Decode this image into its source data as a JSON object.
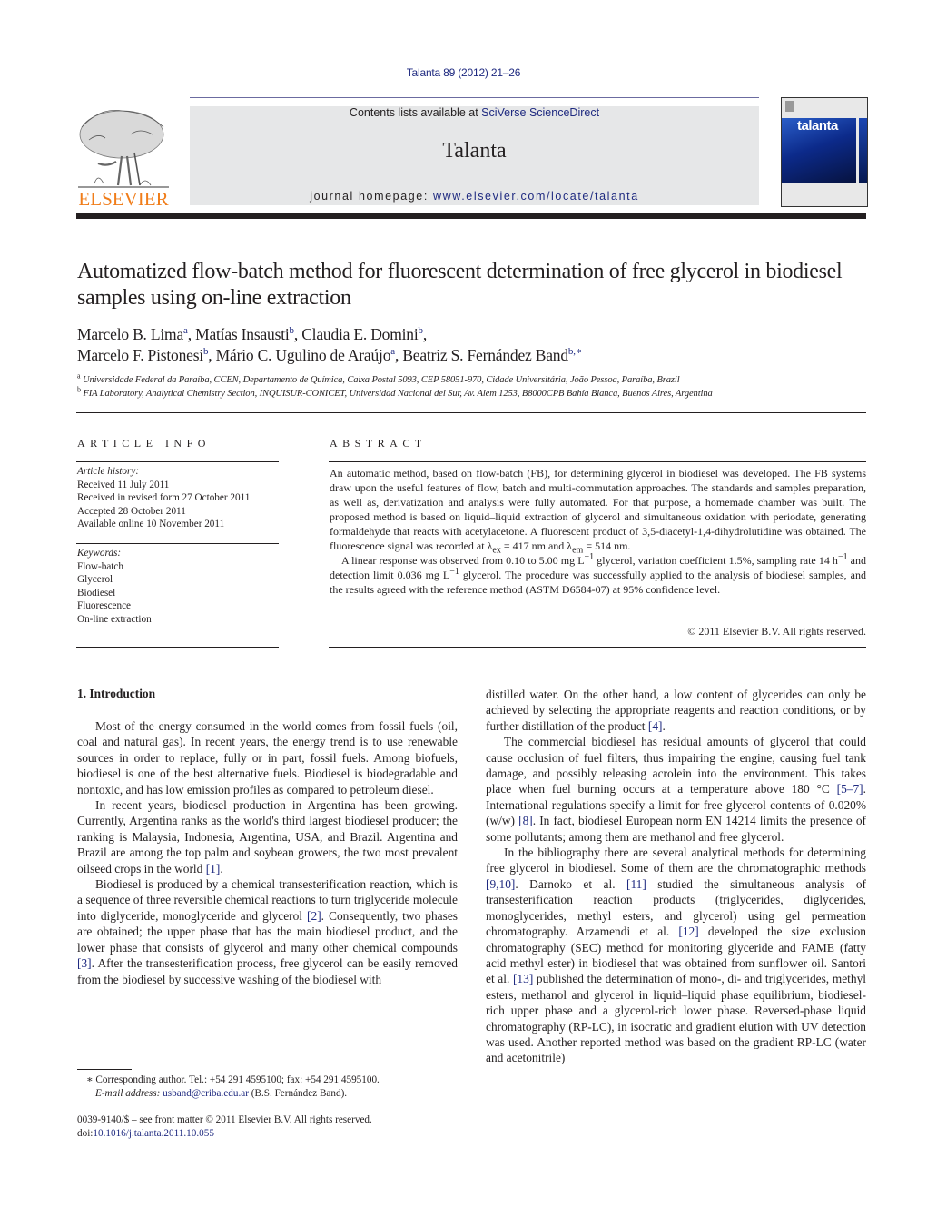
{
  "header": {
    "citation": "Talanta 89 (2012) 21–26",
    "contents_prefix": "Contents lists available at ",
    "contents_link": "SciVerse ScienceDirect",
    "journal_title": "Talanta",
    "homepage_prefix": "journal homepage: ",
    "homepage_link": "www.elsevier.com/locate/talanta",
    "publisher_logo": "ELSEVIER",
    "cover_word": "talanta",
    "colors": {
      "link": "#1f2a80",
      "publisher_orange": "#f07d1a",
      "band": "#e6e7e8"
    }
  },
  "article": {
    "title": "Automatized flow-batch method for fluorescent determination of free glycerol in biodiesel samples using on-line extraction",
    "authors": [
      {
        "name": "Marcelo B. Lima",
        "aff": "a",
        "sep": ", "
      },
      {
        "name": "Matías Insausti",
        "aff": "b",
        "sep": ", "
      },
      {
        "name": "Claudia E. Domini",
        "aff": "b",
        "sep": ",",
        "break_after": true
      },
      {
        "name": "Marcelo F. Pistonesi",
        "aff": "b",
        "sep": ", "
      },
      {
        "name": "Mário C. Ugulino de Araújo",
        "aff": "a",
        "sep": ", "
      },
      {
        "name": "Beatriz S. Fernández Band",
        "aff": "b,∗",
        "sep": ""
      }
    ],
    "affiliations": [
      {
        "key": "a",
        "text": "Universidade Federal da Paraíba, CCEN, Departamento de Química, Caixa Postal 5093, CEP 58051-970, Cidade Universitária, João Pessoa, Paraíba, Brazil"
      },
      {
        "key": "b",
        "text": "FIA Laboratory, Analytical Chemistry Section, INQUISUR-CONICET, Universidad Nacional del Sur, Av. Alem 1253, B8000CPB Bahía Blanca, Buenos Aires, Argentina"
      }
    ]
  },
  "article_info": {
    "heading": "ARTICLE INFO",
    "history_label": "Article history:",
    "history": [
      "Received 11 July 2011",
      "Received in revised form 27 October 2011",
      "Accepted 28 October 2011",
      "Available online 10 November 2011"
    ],
    "keywords_label": "Keywords:",
    "keywords": [
      "Flow-batch",
      "Glycerol",
      "Biodiesel",
      "Fluorescence",
      "On-line extraction"
    ]
  },
  "abstract": {
    "heading": "ABSTRACT",
    "p1_a": "An automatic method, based on flow-batch (FB), for determining glycerol in biodiesel was developed. The FB systems draw upon the useful features of flow, batch and multi-commutation approaches. The standards and samples preparation, as well as, derivatization and analysis were fully automated. For that purpose, a homemade chamber was built. The proposed method is based on liquid–liquid extraction of glycerol and simultaneous oxidation with periodate, generating formaldehyde that reacts with acetylacetone. A fluorescent product of 3,5-diacetyl-1,4-dihydrolutidine was obtained. The fluorescence signal was recorded at λ",
    "p1_sub1": "ex",
    "p1_b": " = 417 nm and λ",
    "p1_sub2": "em",
    "p1_c": " = 514 nm.",
    "p2_a": "A linear response was observed from 0.10 to 5.00 mg L",
    "p2_sup1": "−1",
    "p2_b": " glycerol, variation coefficient 1.5%, sampling rate 14 h",
    "p2_sup2": "−1",
    "p2_c": " and detection limit 0.036 mg L",
    "p2_sup3": "−1",
    "p2_d": " glycerol. The procedure was successfully applied to the analysis of biodiesel samples, and the results agreed with the reference method (ASTM D6584-07) at 95% confidence level.",
    "copyright": "© 2011 Elsevier B.V. All rights reserved."
  },
  "body": {
    "section_heading": "1.  Introduction",
    "left": {
      "p1": "Most of the energy consumed in the world comes from fossil fuels (oil, coal and natural gas). In recent years, the energy trend is to use renewable sources in order to replace, fully or in part, fossil fuels. Among biofuels, biodiesel is one of the best alternative fuels. Biodiesel is biodegradable and nontoxic, and has low emission profiles as compared to petroleum diesel.",
      "p2_a": "In recent years, biodiesel production in Argentina has been growing. Currently, Argentina ranks as the world's third largest biodiesel producer; the ranking is Malaysia, Indonesia, Argentina, USA, and Brazil. Argentina and Brazil are among the top palm and soybean growers, the two most prevalent oilseed crops in the world ",
      "p2_ref1": "[1]",
      "p2_b": ".",
      "p3_a": "Biodiesel is produced by a chemical transesterification reaction, which is a sequence of three reversible chemical reactions to turn triglyceride molecule into diglyceride, monoglyceride and glycerol ",
      "p3_ref2": "[2]",
      "p3_b": ". Consequently, two phases are obtained; the upper phase that has the main biodiesel product, and the lower phase that consists of glycerol and many other chemical compounds ",
      "p3_ref3": "[3]",
      "p3_c": ". After the transesterification process, free glycerol can be easily removed from the biodiesel by successive washing of the biodiesel with"
    },
    "right": {
      "p0_a": "distilled water. On the other hand, a low content of glycerides can only be achieved by selecting the appropriate reagents and reaction conditions, or by further distillation of the product ",
      "p0_ref4": "[4]",
      "p0_b": ".",
      "p1_a": "The commercial biodiesel has residual amounts of glycerol that could cause occlusion of fuel filters, thus impairing the engine, causing fuel tank damage, and possibly releasing acrolein into the environment. This takes place when fuel burning occurs at a temperature above 180 °C ",
      "p1_ref57": "[5–7]",
      "p1_b": ". International regulations specify a limit for free glycerol contents of 0.020% (w/w) ",
      "p1_ref8": "[8]",
      "p1_c": ". In fact, biodiesel European norm EN 14214 limits the presence of some pollutants; among them are methanol and free glycerol.",
      "p2_a": "In the bibliography there are several analytical methods for determining free glycerol in biodiesel. Some of them are the chromatographic methods ",
      "p2_ref910": "[9,10]",
      "p2_b": ". Darnoko et al. ",
      "p2_ref11": "[11]",
      "p2_c": " studied the simultaneous analysis of transesterification reaction products (triglycerides, diglycerides, monoglycerides, methyl esters, and glycerol) using gel permeation chromatography. Arzamendi et al. ",
      "p2_ref12": "[12]",
      "p2_d": " developed the size exclusion chromatography (SEC) method for monitoring glyceride and FAME (fatty acid methyl ester) in biodiesel that was obtained from sunflower oil. Santori et al. ",
      "p2_ref13": "[13]",
      "p2_e": " published the determination of mono-, di- and triglycerides, methyl esters, methanol and glycerol in liquid–liquid phase equilibrium, biodiesel-rich upper phase and a glycerol-rich lower phase. Reversed-phase liquid chromatography (RP-LC), in isocratic and gradient elution with UV detection was used. Another reported method was based on the gradient RP-LC (water and acetonitrile)"
    }
  },
  "footnote": {
    "star": "∗",
    "corresponding": " Corresponding author. Tel.: +54 291 4595100; fax: +54 291 4595100.",
    "email_label": "E-mail address: ",
    "email": "usband@criba.edu.ar",
    "email_suffix": " (B.S. Fernández Band)."
  },
  "front_matter": {
    "issn_line": "0039-9140/$ – see front matter © 2011 Elsevier B.V. All rights reserved.",
    "doi_prefix": "doi:",
    "doi": "10.1016/j.talanta.2011.10.055"
  }
}
